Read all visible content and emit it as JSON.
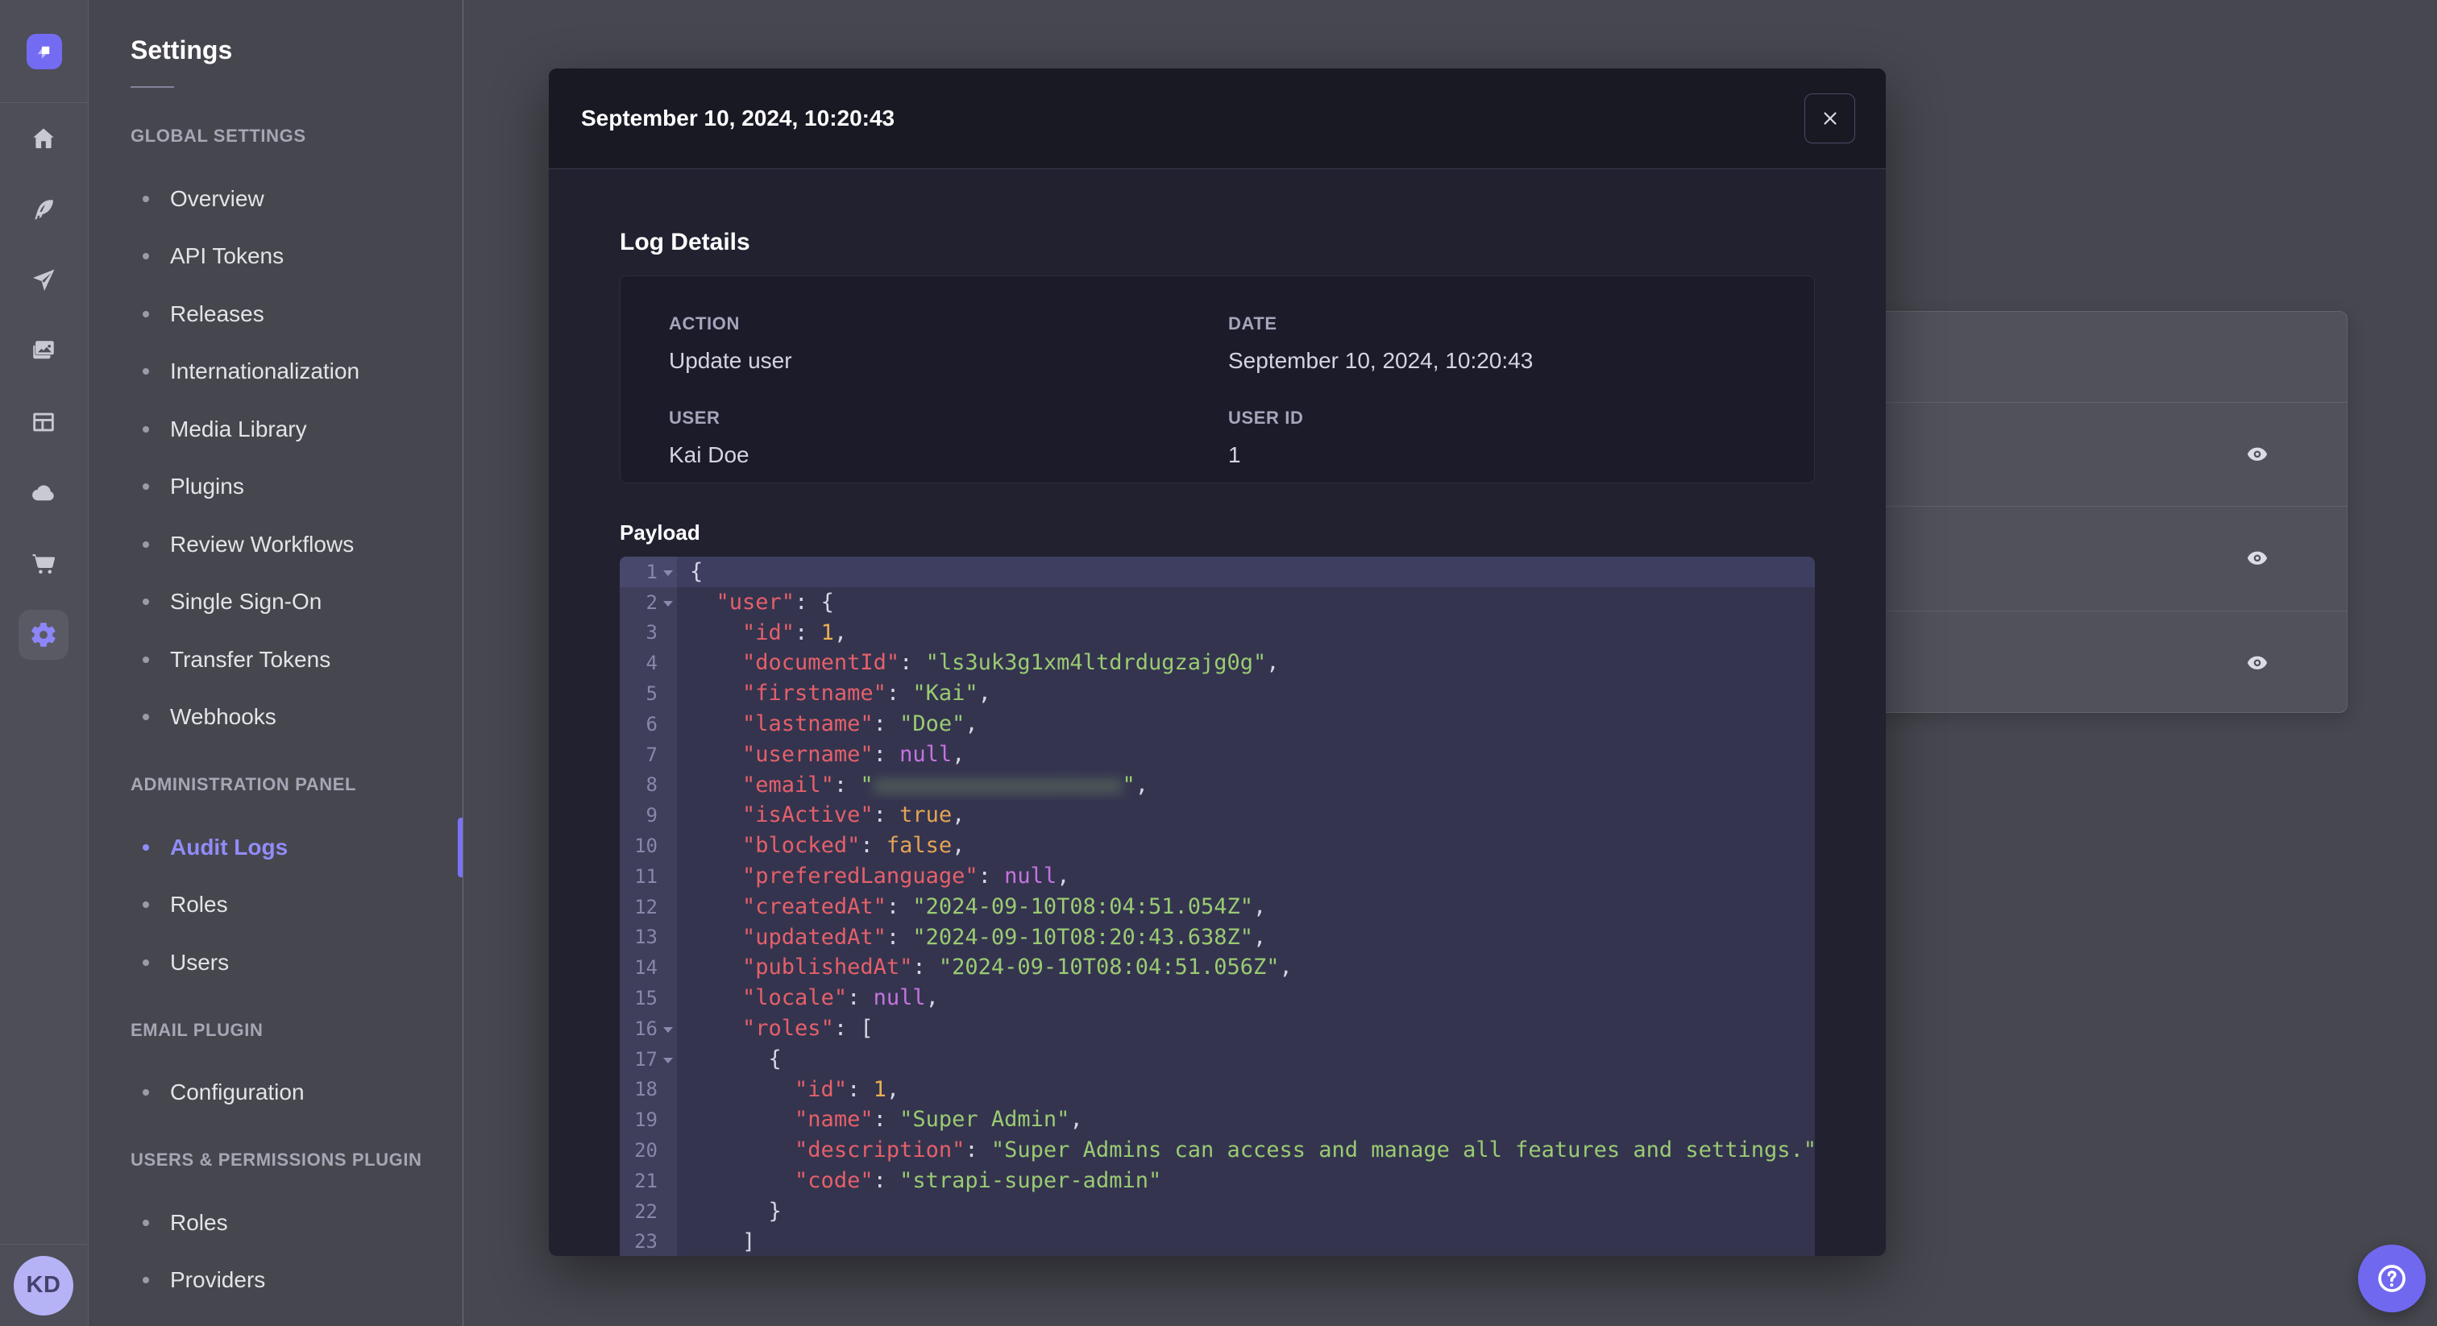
{
  "rail": {
    "icons": [
      {
        "name": "home-icon"
      },
      {
        "name": "content-manager-feather-icon"
      },
      {
        "name": "content-type-builder-send-icon"
      },
      {
        "name": "media-library-pictures-icon"
      },
      {
        "name": "layout-icon"
      },
      {
        "name": "deploy-cloud-icon"
      },
      {
        "name": "marketplace-cart-icon"
      },
      {
        "name": "settings-gear-icon",
        "active": true
      }
    ],
    "avatar_initials": "KD"
  },
  "sidebar": {
    "title": "Settings",
    "sections": [
      {
        "label": "GLOBAL SETTINGS",
        "items": [
          {
            "label": "Overview"
          },
          {
            "label": "API Tokens"
          },
          {
            "label": "Releases"
          },
          {
            "label": "Internationalization"
          },
          {
            "label": "Media Library"
          },
          {
            "label": "Plugins"
          },
          {
            "label": "Review Workflows"
          },
          {
            "label": "Single Sign-On"
          },
          {
            "label": "Transfer Tokens"
          },
          {
            "label": "Webhooks"
          }
        ]
      },
      {
        "label": "ADMINISTRATION PANEL",
        "items": [
          {
            "label": "Audit Logs",
            "active": true
          },
          {
            "label": "Roles"
          },
          {
            "label": "Users"
          }
        ]
      },
      {
        "label": "EMAIL PLUGIN",
        "items": [
          {
            "label": "Configuration"
          }
        ]
      },
      {
        "label": "USERS & PERMISSIONS PLUGIN",
        "items": [
          {
            "label": "Roles"
          },
          {
            "label": "Providers"
          }
        ]
      }
    ]
  },
  "background_table": {
    "visible_rows": 3,
    "row_action_icon": "eye-icon"
  },
  "modal": {
    "title": "September 10, 2024, 10:20:43",
    "close_icon": "close-icon",
    "section_title": "Log Details",
    "details": [
      {
        "label": "ACTION",
        "value": "Update user"
      },
      {
        "label": "DATE",
        "value": "September 10, 2024, 10:20:43"
      },
      {
        "label": "USER",
        "value": "Kai Doe"
      },
      {
        "label": "USER ID",
        "value": "1"
      }
    ],
    "payload_label": "Payload",
    "payload_code": {
      "language": "json",
      "note_line8_email_is_blurred_in_screenshot": true,
      "lines": [
        {
          "n": 1,
          "fold": true,
          "tokens": [
            [
              "p",
              "{"
            ]
          ]
        },
        {
          "n": 2,
          "fold": true,
          "tokens": [
            [
              "p",
              "  "
            ],
            [
              "k",
              "\"user\""
            ],
            [
              "p",
              ": {"
            ]
          ]
        },
        {
          "n": 3,
          "fold": false,
          "tokens": [
            [
              "p",
              "    "
            ],
            [
              "k",
              "\"id\""
            ],
            [
              "p",
              ": "
            ],
            [
              "n",
              "1"
            ],
            [
              "p",
              ","
            ]
          ]
        },
        {
          "n": 4,
          "fold": false,
          "tokens": [
            [
              "p",
              "    "
            ],
            [
              "k",
              "\"documentId\""
            ],
            [
              "p",
              ": "
            ],
            [
              "s",
              "\"ls3uk3g1xm4ltdrdugzajg0g\""
            ],
            [
              "p",
              ","
            ]
          ]
        },
        {
          "n": 5,
          "fold": false,
          "tokens": [
            [
              "p",
              "    "
            ],
            [
              "k",
              "\"firstname\""
            ],
            [
              "p",
              ": "
            ],
            [
              "s",
              "\"Kai\""
            ],
            [
              "p",
              ","
            ]
          ]
        },
        {
          "n": 6,
          "fold": false,
          "tokens": [
            [
              "p",
              "    "
            ],
            [
              "k",
              "\"lastname\""
            ],
            [
              "p",
              ": "
            ],
            [
              "s",
              "\"Doe\""
            ],
            [
              "p",
              ","
            ]
          ]
        },
        {
          "n": 7,
          "fold": false,
          "tokens": [
            [
              "p",
              "    "
            ],
            [
              "k",
              "\"username\""
            ],
            [
              "p",
              ": "
            ],
            [
              "u",
              "null"
            ],
            [
              "p",
              ","
            ]
          ]
        },
        {
          "n": 8,
          "fold": false,
          "tokens": [
            [
              "p",
              "    "
            ],
            [
              "k",
              "\"email\""
            ],
            [
              "p",
              ": "
            ],
            [
              "s",
              "\""
            ],
            [
              "x",
              "xxxxxxxxxxxxxxxxxxx"
            ],
            [
              "s",
              "\""
            ],
            [
              "p",
              ","
            ]
          ]
        },
        {
          "n": 9,
          "fold": false,
          "tokens": [
            [
              "p",
              "    "
            ],
            [
              "k",
              "\"isActive\""
            ],
            [
              "p",
              ": "
            ],
            [
              "b",
              "true"
            ],
            [
              "p",
              ","
            ]
          ]
        },
        {
          "n": 10,
          "fold": false,
          "tokens": [
            [
              "p",
              "    "
            ],
            [
              "k",
              "\"blocked\""
            ],
            [
              "p",
              ": "
            ],
            [
              "b",
              "false"
            ],
            [
              "p",
              ","
            ]
          ]
        },
        {
          "n": 11,
          "fold": false,
          "tokens": [
            [
              "p",
              "    "
            ],
            [
              "k",
              "\"preferedLanguage\""
            ],
            [
              "p",
              ": "
            ],
            [
              "u",
              "null"
            ],
            [
              "p",
              ","
            ]
          ]
        },
        {
          "n": 12,
          "fold": false,
          "tokens": [
            [
              "p",
              "    "
            ],
            [
              "k",
              "\"createdAt\""
            ],
            [
              "p",
              ": "
            ],
            [
              "s",
              "\"2024-09-10T08:04:51.054Z\""
            ],
            [
              "p",
              ","
            ]
          ]
        },
        {
          "n": 13,
          "fold": false,
          "tokens": [
            [
              "p",
              "    "
            ],
            [
              "k",
              "\"updatedAt\""
            ],
            [
              "p",
              ": "
            ],
            [
              "s",
              "\"2024-09-10T08:20:43.638Z\""
            ],
            [
              "p",
              ","
            ]
          ]
        },
        {
          "n": 14,
          "fold": false,
          "tokens": [
            [
              "p",
              "    "
            ],
            [
              "k",
              "\"publishedAt\""
            ],
            [
              "p",
              ": "
            ],
            [
              "s",
              "\"2024-09-10T08:04:51.056Z\""
            ],
            [
              "p",
              ","
            ]
          ]
        },
        {
          "n": 15,
          "fold": false,
          "tokens": [
            [
              "p",
              "    "
            ],
            [
              "k",
              "\"locale\""
            ],
            [
              "p",
              ": "
            ],
            [
              "u",
              "null"
            ],
            [
              "p",
              ","
            ]
          ]
        },
        {
          "n": 16,
          "fold": true,
          "tokens": [
            [
              "p",
              "    "
            ],
            [
              "k",
              "\"roles\""
            ],
            [
              "p",
              ": ["
            ]
          ]
        },
        {
          "n": 17,
          "fold": true,
          "tokens": [
            [
              "p",
              "      {"
            ]
          ]
        },
        {
          "n": 18,
          "fold": false,
          "tokens": [
            [
              "p",
              "        "
            ],
            [
              "k",
              "\"id\""
            ],
            [
              "p",
              ": "
            ],
            [
              "n",
              "1"
            ],
            [
              "p",
              ","
            ]
          ]
        },
        {
          "n": 19,
          "fold": false,
          "tokens": [
            [
              "p",
              "        "
            ],
            [
              "k",
              "\"name\""
            ],
            [
              "p",
              ": "
            ],
            [
              "s",
              "\"Super Admin\""
            ],
            [
              "p",
              ","
            ]
          ]
        },
        {
          "n": 20,
          "fold": false,
          "tokens": [
            [
              "p",
              "        "
            ],
            [
              "k",
              "\"description\""
            ],
            [
              "p",
              ": "
            ],
            [
              "s",
              "\"Super Admins can access and manage all features and settings.\""
            ],
            [
              "p",
              ","
            ]
          ]
        },
        {
          "n": 21,
          "fold": false,
          "tokens": [
            [
              "p",
              "        "
            ],
            [
              "k",
              "\"code\""
            ],
            [
              "p",
              ": "
            ],
            [
              "s",
              "\"strapi-super-admin\""
            ]
          ]
        },
        {
          "n": 22,
          "fold": false,
          "tokens": [
            [
              "p",
              "      }"
            ]
          ]
        },
        {
          "n": 23,
          "fold": false,
          "tokens": [
            [
              "p",
              "    ]"
            ]
          ]
        }
      ]
    }
  },
  "help_button": {
    "icon": "question-mark-icon"
  },
  "colors": {
    "accent_purple": "#7b73f5",
    "active_item_text": "#918cf9",
    "modal_bg": "#212130",
    "modal_header_bg": "#191924",
    "code_bg": "#34344f",
    "syntax_key": "#e56069",
    "syntax_string": "#9acb72",
    "syntax_number": "#eab050",
    "syntax_boolean": "#e5a455",
    "syntax_null": "#c573de"
  }
}
